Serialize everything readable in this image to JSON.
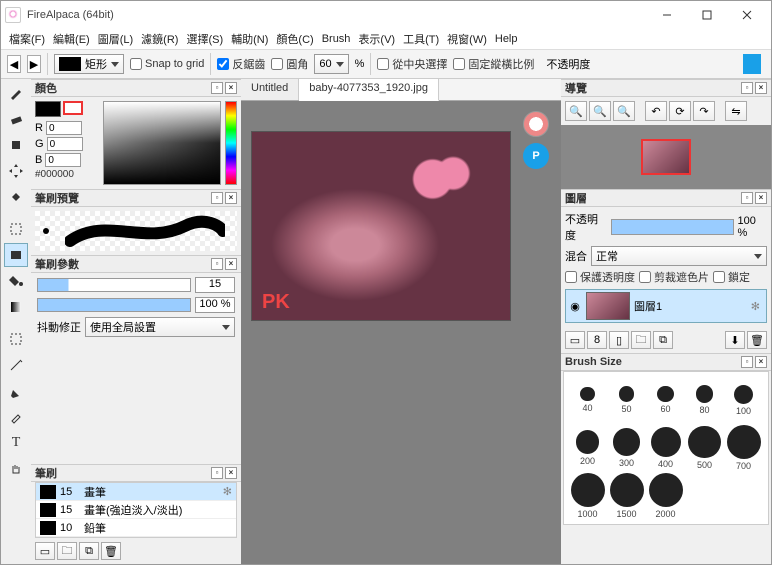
{
  "window": {
    "title": "FireAlpaca (64bit)"
  },
  "menu": [
    "檔案(F)",
    "編輯(E)",
    "圖層(L)",
    "濾鏡(R)",
    "選擇(S)",
    "輔助(N)",
    "顏色(C)",
    "Brush",
    "表示(V)",
    "工具(T)",
    "視窗(W)",
    "Help"
  ],
  "optbar": {
    "shape_label": "矩形",
    "snap": "Snap to grid",
    "antialias": "反鋸齒",
    "round": "圓角",
    "round_val": "60",
    "percent": "%",
    "center": "從中央選擇",
    "fixratio": "固定縱橫比例",
    "opacity_label": "不透明度"
  },
  "color": {
    "title": "顏色",
    "r_lbl": "R",
    "r": "0",
    "g_lbl": "G",
    "g": "0",
    "b_lbl": "B",
    "b": "0",
    "hex": "#000000"
  },
  "brush_preview": {
    "title": "筆刷預覽"
  },
  "brush_params": {
    "title": "筆刷參數",
    "size": "15",
    "opacity": "100 %",
    "jitter_lbl": "抖動修正",
    "jitter_val": "使用全局設置"
  },
  "brush_list": {
    "title": "筆刷",
    "items": [
      {
        "size": "15",
        "name": "畫筆",
        "sel": true
      },
      {
        "size": "15",
        "name": "畫筆(強迫淡入/淡出)",
        "sel": false
      },
      {
        "size": "10",
        "name": "鉛筆",
        "sel": false
      }
    ]
  },
  "tabs": [
    {
      "label": "Untitled",
      "active": false
    },
    {
      "label": "baby-4077353_1920.jpg",
      "active": true
    }
  ],
  "nav": {
    "title": "導覽"
  },
  "layers": {
    "title": "圖層",
    "opacity_lbl": "不透明度",
    "opacity_val": "100 %",
    "blend_lbl": "混合",
    "blend_val": "正常",
    "protect": "保護透明度",
    "clip": "剪裁遮色片",
    "lock": "鎖定",
    "layer_name": "圖層1"
  },
  "brush_size": {
    "title": "Brush Size",
    "sizes": [
      40,
      50,
      60,
      80,
      100,
      200,
      300,
      400,
      500,
      700,
      1000,
      1500,
      2000
    ]
  }
}
